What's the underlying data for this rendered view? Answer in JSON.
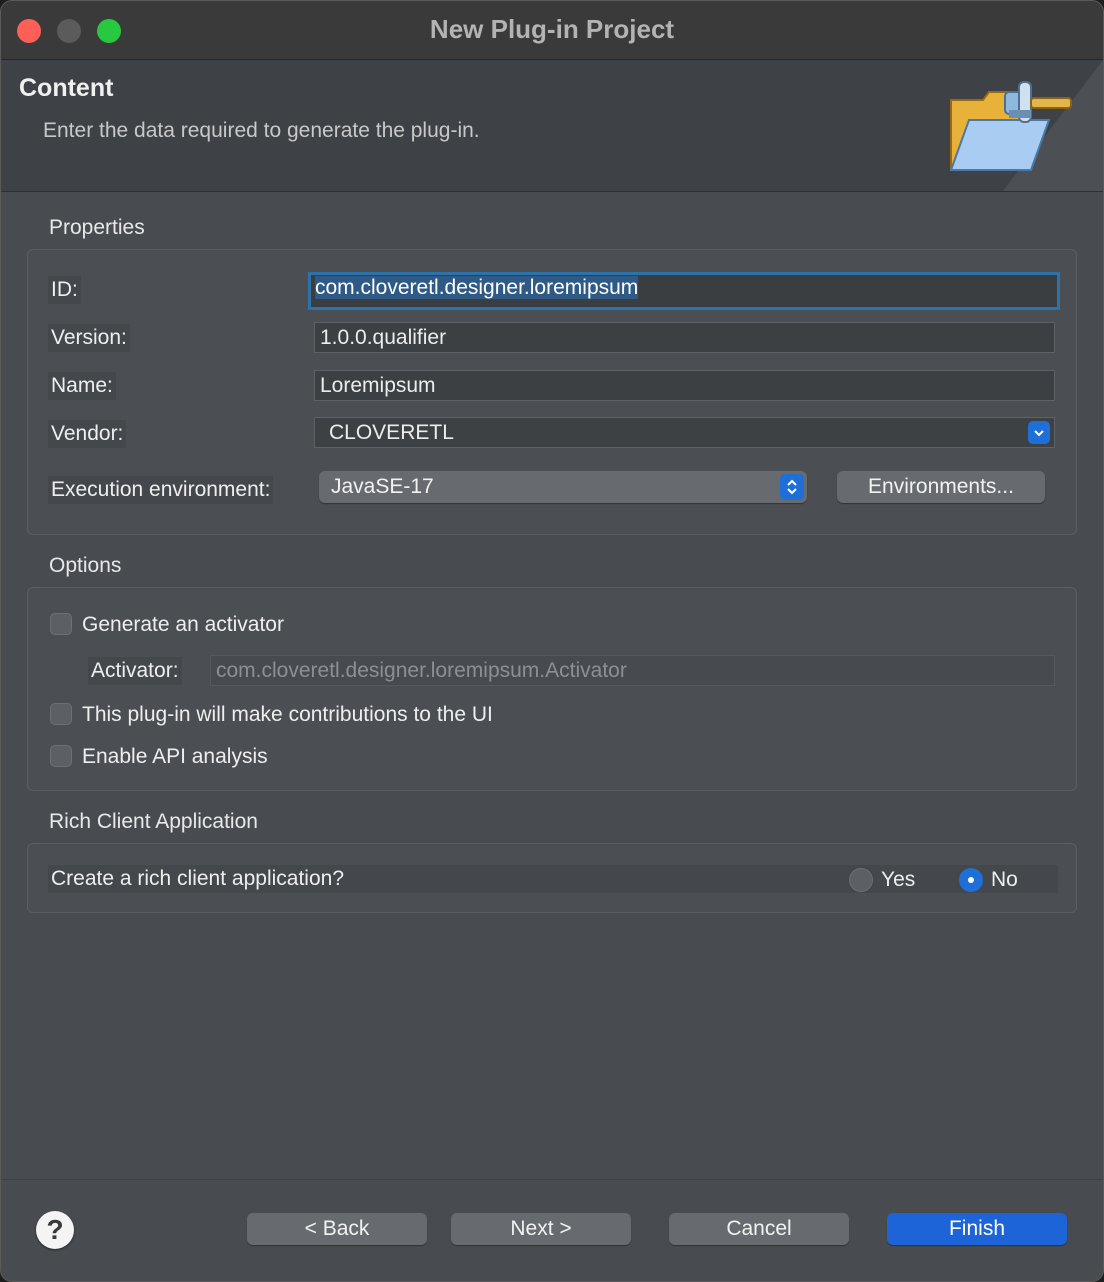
{
  "window": {
    "title": "New Plug-in Project"
  },
  "header": {
    "title": "Content",
    "description": "Enter the data required to generate the plug-in."
  },
  "properties": {
    "section": "Properties",
    "id_label": "ID:",
    "id_value": "com.cloveretl.designer.loremipsum",
    "version_label": "Version:",
    "version_value": "1.0.0.qualifier",
    "name_label": "Name:",
    "name_value": "Loremipsum",
    "vendor_label": "Vendor:",
    "vendor_value": "CLOVERETL",
    "exec_env_label": "Execution environment:",
    "exec_env_value": "JavaSE-17",
    "environments_button": "Environments..."
  },
  "options": {
    "section": "Options",
    "generate_activator_label": "Generate an activator",
    "generate_activator_checked": false,
    "activator_label": "Activator:",
    "activator_value": "com.cloveretl.designer.loremipsum.Activator",
    "ui_contrib_label": "This plug-in will make contributions to the UI",
    "ui_contrib_checked": false,
    "api_analysis_label": "Enable API analysis",
    "api_analysis_checked": false
  },
  "rca": {
    "section": "Rich Client Application",
    "question": "Create a rich client application?",
    "yes_label": "Yes",
    "no_label": "No",
    "selected": "No"
  },
  "footer": {
    "help_icon_text": "?",
    "back": "< Back",
    "next": "Next >",
    "cancel": "Cancel",
    "finish": "Finish"
  },
  "colors": {
    "accent": "#1f6fd8",
    "focus_ring": "#2d72a8",
    "close": "#fe5f57",
    "maximize": "#28c840"
  }
}
